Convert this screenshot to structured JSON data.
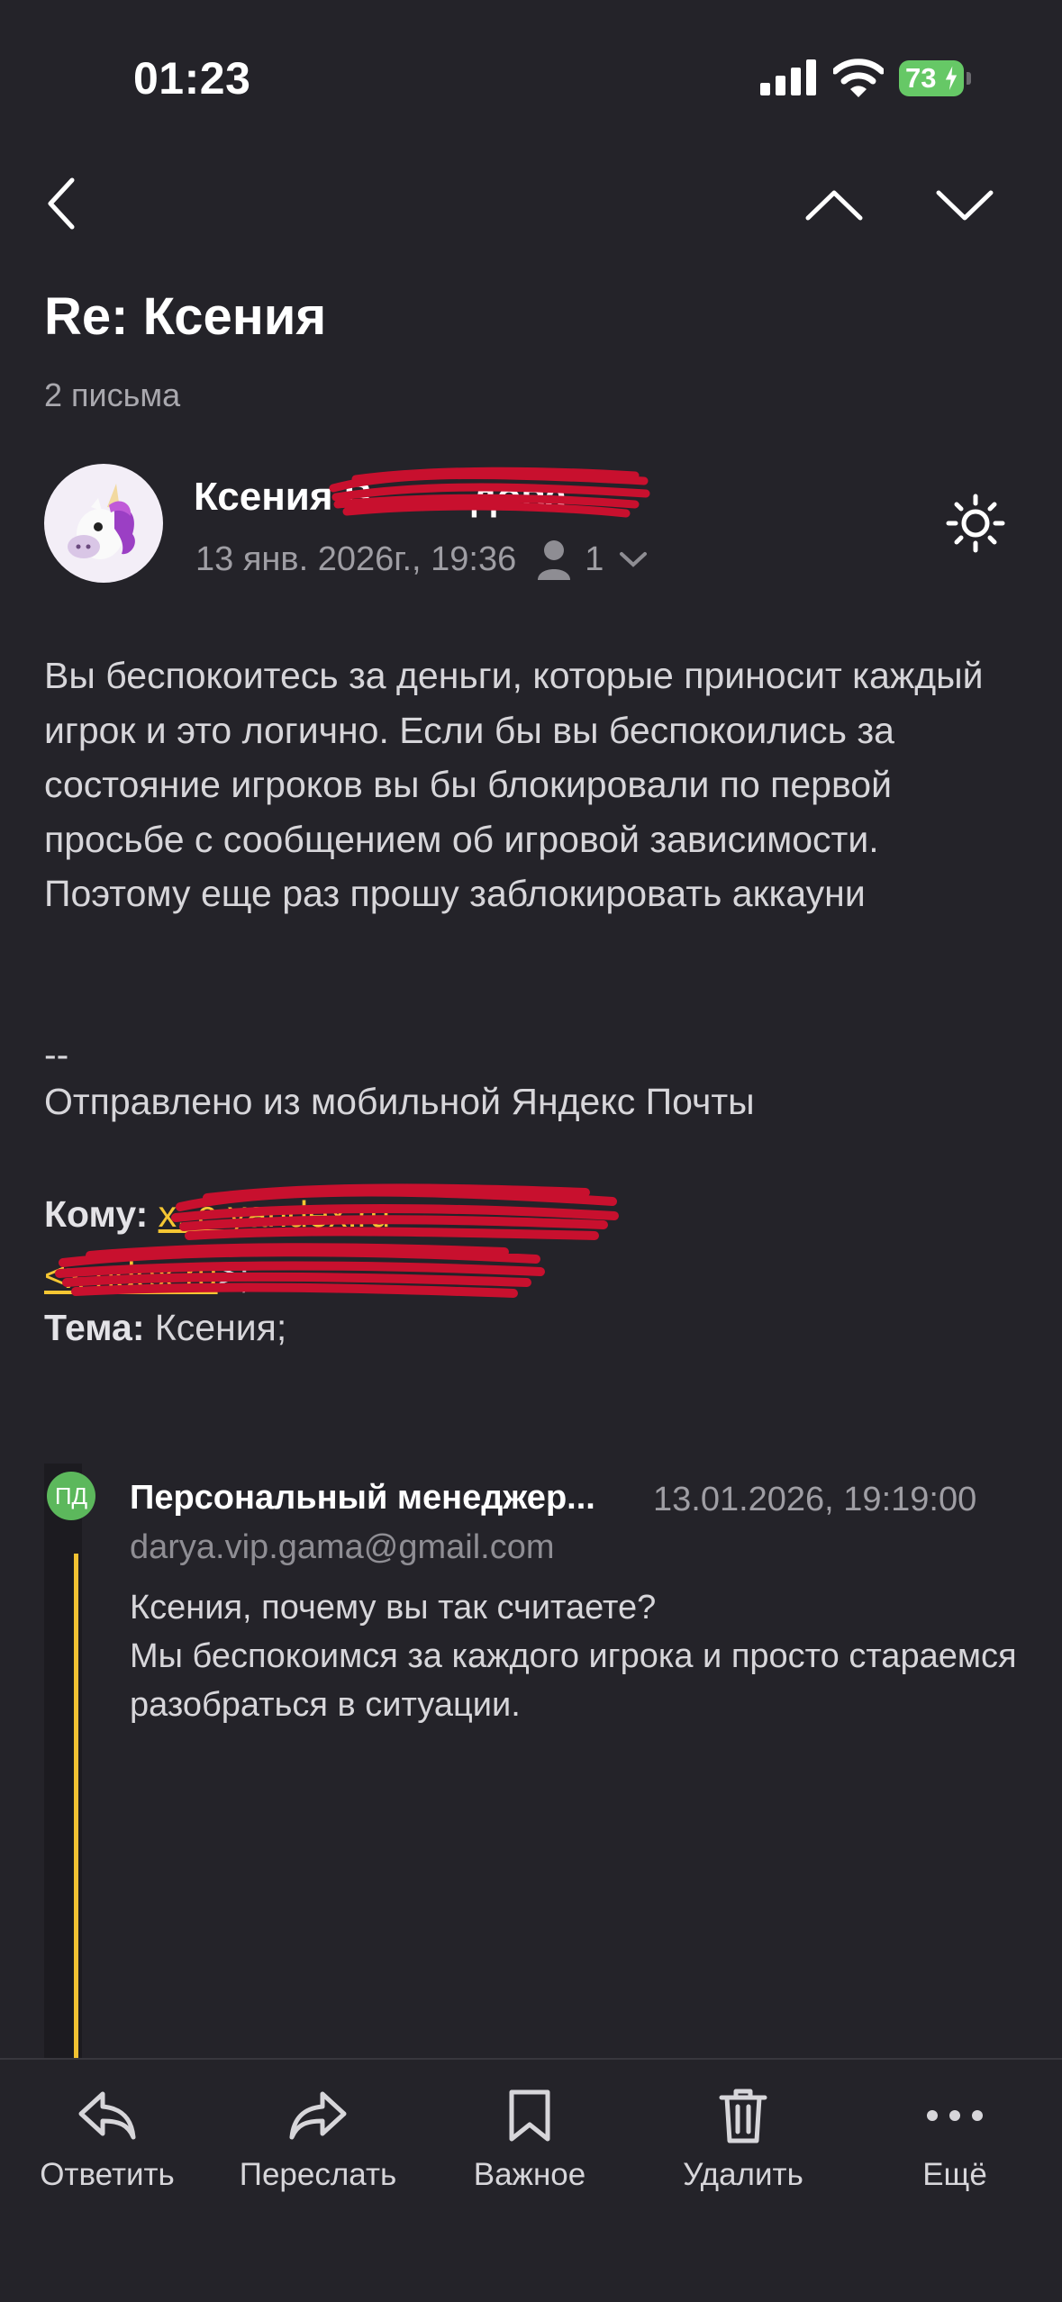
{
  "status": {
    "time": "01:23",
    "battery": "73"
  },
  "header": {
    "title": "Re: Ксения",
    "count": "2 письма"
  },
  "sender": {
    "name": "Ксения В",
    "name_tail": "дова",
    "date": "13 янв. 2026г., 19:36",
    "recipients_count": "1"
  },
  "message": {
    "body": "Вы беспокоитесь за деньги, которые приносит каждый игрок и это логично. Если бы вы беспокоились за состояние игроков вы бы блокировали по первой просьбе с сообщением об игровой зависимости. Поэтому еще раз прошу заблокировать аккауни",
    "separator": "--",
    "signature": "Отправлено из мобильной Яндекс Почты",
    "to_label": "Кому:",
    "to_value": "x.            e.yandex.ru",
    "to_value2": "<x               ndex.ru",
    "to_suffix": ">;",
    "subject_label": "Тема:",
    "subject_value": "Ксения;"
  },
  "quoted": {
    "initials": "ПД",
    "name": "Персональный менеджер...",
    "date": "13.01.2026, 19:19:00",
    "email": "darya.vip.gama@gmail.com",
    "text": "Ксения, почему вы так считаете?\n Мы беспокоимся за каждого игрока и просто стараемся разобраться в ситуации."
  },
  "toolbar": {
    "reply": "Ответить",
    "forward": "Переслать",
    "important": "Важное",
    "delete": "Удалить",
    "more": "Ещё"
  },
  "colors": {
    "background": "#242329",
    "accent": "#f5c633",
    "badge": "#5cb85c"
  }
}
